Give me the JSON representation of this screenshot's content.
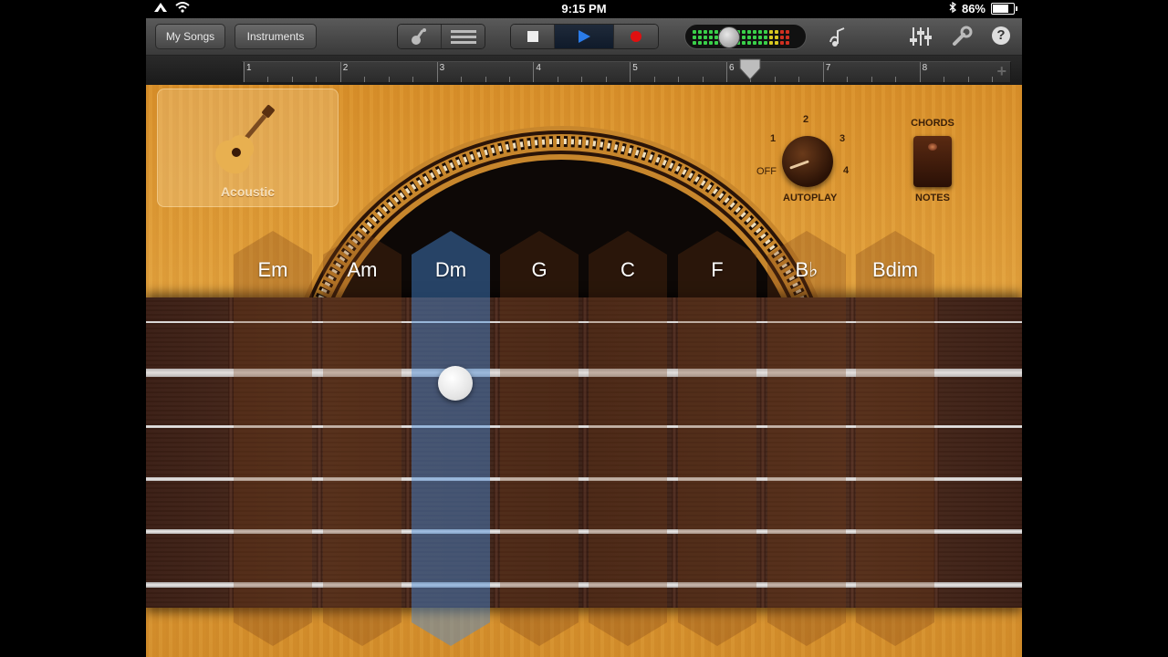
{
  "status_bar": {
    "time": "9:15 PM",
    "battery_text": "86%",
    "battery_level": 0.86,
    "icons": [
      "airplane-icon",
      "wifi-icon",
      "bluetooth-icon"
    ]
  },
  "toolbar": {
    "my_songs_label": "My Songs",
    "instruments_label": "Instruments",
    "view_icons": [
      "guitar-view-icon",
      "tracks-view-icon"
    ],
    "transport_icons": [
      "stop-icon",
      "play-icon",
      "record-icon"
    ],
    "right_icons": [
      "metronome-icon",
      "mixer-icon",
      "wrench-icon",
      "help-icon"
    ],
    "help_glyph": "?"
  },
  "timeline": {
    "bars": [
      "1",
      "2",
      "3",
      "4",
      "5",
      "6",
      "7",
      "8"
    ],
    "playhead_bar": 6.3,
    "add_glyph": "+"
  },
  "instrument": {
    "name": "Acoustic",
    "icon": "acoustic-guitar-icon"
  },
  "autoplay": {
    "title": "AUTOPLAY",
    "positions": [
      "OFF",
      "1",
      "2",
      "3",
      "4"
    ],
    "selected": "OFF"
  },
  "mode_switch": {
    "top_label": "CHORDS",
    "bottom_label": "NOTES",
    "selected": "CHORDS"
  },
  "chords": [
    "Em",
    "Am",
    "Dm",
    "G",
    "C",
    "F",
    "B♭",
    "Bdim"
  ],
  "active_chord": "Dm",
  "colors": {
    "wood": "#e0a03a",
    "fretboard": "#3e2218",
    "active_strip": "#4a8ad8",
    "record": "#e01010",
    "play": "#2a7be8"
  }
}
